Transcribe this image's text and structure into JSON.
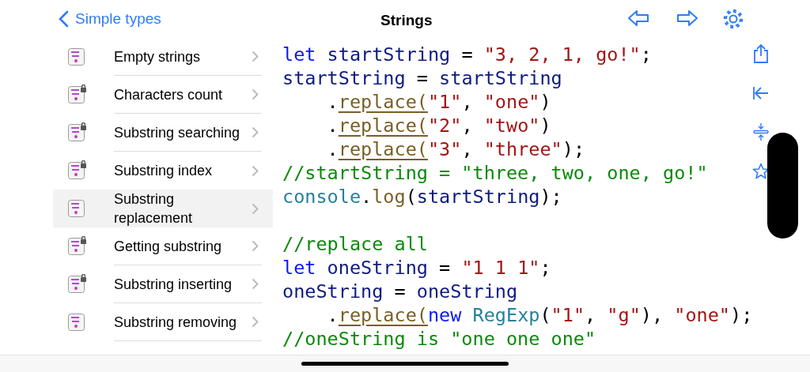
{
  "nav": {
    "back": "Simple types",
    "title": "Strings"
  },
  "sidebar": {
    "items": [
      {
        "label": "Empty strings",
        "locked": false,
        "selected": false
      },
      {
        "label": "Characters count",
        "locked": true,
        "selected": false
      },
      {
        "label": "Substring searching",
        "locked": true,
        "selected": false
      },
      {
        "label": "Substring index",
        "locked": true,
        "selected": false
      },
      {
        "label": "Substring replacement",
        "locked": false,
        "selected": true
      },
      {
        "label": "Getting substring",
        "locked": true,
        "selected": false
      },
      {
        "label": "Substring inserting",
        "locked": true,
        "selected": false
      },
      {
        "label": "Substring removing",
        "locked": false,
        "selected": false
      }
    ]
  },
  "code": {
    "lines": [
      [
        {
          "kind": "keyword",
          "text": "let"
        },
        {
          "kind": "ident",
          "text": " startString"
        },
        {
          "kind": "punct",
          "text": " = "
        },
        {
          "kind": "string",
          "text": "\"3, 2, 1, go!\""
        },
        {
          "kind": "punct",
          "text": ";"
        }
      ],
      [
        {
          "kind": "ident",
          "text": "startString"
        },
        {
          "kind": "punct",
          "text": " = "
        },
        {
          "kind": "ident",
          "text": "startString"
        }
      ],
      [
        {
          "kind": "punct",
          "text": "    ."
        },
        {
          "kind": "method",
          "text": "replace("
        },
        {
          "kind": "string",
          "text": "\"1\""
        },
        {
          "kind": "punct",
          "text": ", "
        },
        {
          "kind": "string",
          "text": "\"one\""
        },
        {
          "kind": "punct",
          "text": ")"
        }
      ],
      [
        {
          "kind": "punct",
          "text": "    ."
        },
        {
          "kind": "method",
          "text": "replace("
        },
        {
          "kind": "string",
          "text": "\"2\""
        },
        {
          "kind": "punct",
          "text": ", "
        },
        {
          "kind": "string",
          "text": "\"two\""
        },
        {
          "kind": "punct",
          "text": ")"
        }
      ],
      [
        {
          "kind": "punct",
          "text": "    ."
        },
        {
          "kind": "method",
          "text": "replace("
        },
        {
          "kind": "string",
          "text": "\"3\""
        },
        {
          "kind": "punct",
          "text": ", "
        },
        {
          "kind": "string",
          "text": "\"three\""
        },
        {
          "kind": "punct",
          "text": ");"
        }
      ],
      [
        {
          "kind": "comment",
          "text": "//startString = \"three, two, one, go!\""
        }
      ],
      [
        {
          "kind": "class",
          "text": "console"
        },
        {
          "kind": "punct",
          "text": "."
        },
        {
          "kind": "func",
          "text": "log"
        },
        {
          "kind": "punct",
          "text": "("
        },
        {
          "kind": "ident",
          "text": "startString"
        },
        {
          "kind": "punct",
          "text": ");"
        }
      ],
      [
        {
          "kind": "comment",
          "text": "//replace all",
          "gap_before": true
        }
      ],
      [
        {
          "kind": "keyword",
          "text": "let"
        },
        {
          "kind": "ident",
          "text": " oneString"
        },
        {
          "kind": "punct",
          "text": " = "
        },
        {
          "kind": "string",
          "text": "\"1 1 1\""
        },
        {
          "kind": "punct",
          "text": ";"
        }
      ],
      [
        {
          "kind": "ident",
          "text": "oneString"
        },
        {
          "kind": "punct",
          "text": " = "
        },
        {
          "kind": "ident",
          "text": "oneString"
        }
      ],
      [
        {
          "kind": "punct",
          "text": "    ."
        },
        {
          "kind": "method",
          "text": "replace("
        },
        {
          "kind": "keyword",
          "text": "new"
        },
        {
          "kind": "class",
          "text": " RegExp"
        },
        {
          "kind": "punct",
          "text": "("
        },
        {
          "kind": "string",
          "text": "\"1\""
        },
        {
          "kind": "punct",
          "text": ", "
        },
        {
          "kind": "string",
          "text": "\"g\""
        },
        {
          "kind": "punct",
          "text": "), "
        },
        {
          "kind": "string",
          "text": "\"one\""
        },
        {
          "kind": "punct",
          "text": ");"
        }
      ],
      [
        {
          "kind": "comment",
          "text": "//oneString is \"one one one\""
        }
      ]
    ]
  }
}
